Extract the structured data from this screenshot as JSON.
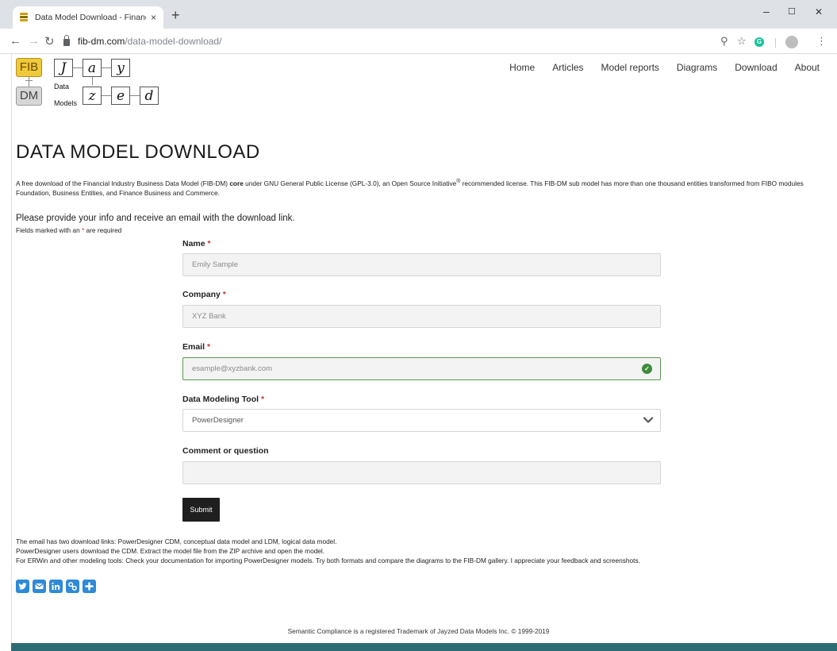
{
  "browser": {
    "tab_title": "Data Model Download - Financia",
    "tab_close": "×",
    "new_tab": "+",
    "url_host": "fib-dm.com",
    "url_path": "/data-model-download/",
    "minimize": "–",
    "maximize": "☐",
    "close": "✕"
  },
  "logo": {
    "fib": "FIB",
    "dm": "DM",
    "word_data": "Data",
    "word_models": "Models",
    "letters_top": [
      "J",
      "a",
      "y"
    ],
    "letters_bottom": [
      "z",
      "e",
      "d"
    ]
  },
  "nav": {
    "items": [
      "Home",
      "Articles",
      "Model reports",
      "Diagrams",
      "Download",
      "About"
    ]
  },
  "page": {
    "title": "DATA MODEL DOWNLOAD",
    "intro_before": "A free download of the Financial Industry Business Data Model (FIB-DM) ",
    "intro_bold": "core",
    "intro_middle": " under GNU General Public License (GPL-3.0), an Open Source Initiative",
    "intro_reg": "®",
    "intro_after": " recommended license. This FIB-DM sub model has more than one thousand entities transformed from FIBO modules Foundation, Business Entities, and Finance Business and Commerce.",
    "ask": "Please provide your info and receive an email with the download link.",
    "required_before": "Fields marked with an ",
    "required_star": "*",
    "required_after": " are required"
  },
  "form": {
    "name_label": "Name",
    "name_value": "Emily Sample",
    "company_label": "Company",
    "company_value": "XYZ Bank",
    "email_label": "Email",
    "email_value": "esample@xyzbank.com",
    "tool_label": "Data Modeling Tool",
    "tool_value": "PowerDesigner",
    "comment_label": "Comment or question",
    "comment_value": "",
    "required_marker": "*",
    "submit_label": "Submit"
  },
  "notes": [
    "The email has two download links: PowerDesigner CDM, conceptual data model and LDM, logical data model.",
    "PowerDesigner users download the CDM. Extract the model file from the ZIP archive and open the model.",
    "For ERWin and other modeling tools: Check your documentation for importing PowerDesigner models. Try both formats and compare the diagrams to the FIB-DM gallery. I appreciate your feedback and screenshots."
  ],
  "share_icons": [
    "twitter-icon",
    "email-icon",
    "linkedin-icon",
    "copy-link-icon",
    "add-share-icon"
  ],
  "footer": "Semantic Compliance is a registered Trademark of Jayzed Data Models Inc. © 1999-2019",
  "colors": {
    "accent": "#2f8ad8",
    "footer_bar": "#2d6c74",
    "required_star": "#c0392b",
    "valid_check": "#3c8d3c"
  }
}
